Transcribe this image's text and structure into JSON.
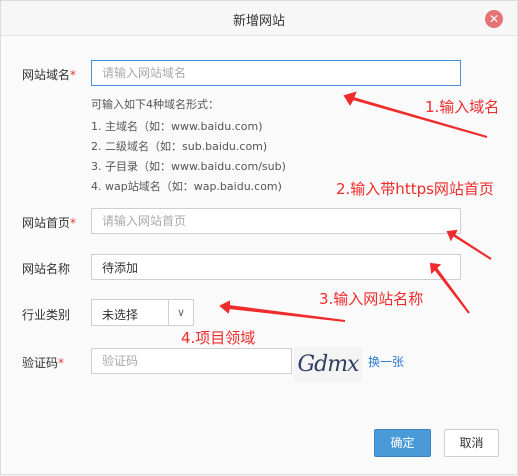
{
  "dialog": {
    "title": "新增网站",
    "close_icon": "close-icon"
  },
  "form": {
    "domain": {
      "label": "网站域名",
      "required": "*",
      "placeholder": "请输入网站域名",
      "value": ""
    },
    "hint": {
      "intro": "可输入如下4种域名形式：",
      "lines": [
        "1. 主域名（如：www.baidu.com)",
        "2. 二级域名（如：sub.baidu.com)",
        "3. 子目录（如：www.baidu.com/sub)",
        "4. wap站域名（如：wap.baidu.com)"
      ]
    },
    "homepage": {
      "label": "网站首页",
      "required": "*",
      "placeholder": "请输入网站首页",
      "value": ""
    },
    "site_name": {
      "label": "网站名称",
      "value": "待添加"
    },
    "industry": {
      "label": "行业类别",
      "selected": "未选择"
    },
    "captcha": {
      "label": "验证码",
      "required": "*",
      "placeholder": "验证码",
      "image_text": "Gdmx",
      "refresh_label": "换一张"
    }
  },
  "buttons": {
    "confirm": "确定",
    "cancel": "取消"
  },
  "annotations": {
    "a1": "1.输入域名",
    "a2": "2.输入带https网站首页",
    "a3": "3.输入网站名称",
    "a4": "4.项目领域",
    "color": "#ef2b2b"
  }
}
